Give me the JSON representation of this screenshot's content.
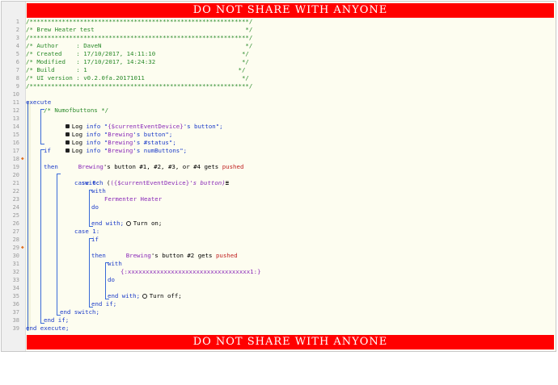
{
  "banner": {
    "top_text": "DO NOT SHARE WITH ANYONE",
    "bottom_text": "DO NOT SHARE WITH ANYONE"
  },
  "line_numbers": [
    "1",
    "2",
    "3",
    "4",
    "5",
    "6",
    "7",
    "8",
    "9",
    "10",
    "11",
    "12",
    "13",
    "14",
    "15",
    "16",
    "17",
    "18",
    "19",
    "20",
    "21",
    "22",
    "23",
    "24",
    "25",
    "26",
    "27",
    "28",
    "29",
    "30",
    "31",
    "32",
    "33",
    "34",
    "35",
    "36",
    "37",
    "38",
    "39"
  ],
  "header_comment": {
    "border": "/*************************************************************/",
    "title": "/* Brew Heater test                                          */",
    "author": "/* Author     : DaveN                                        */",
    "created": "/* Created    : 17/10/2017, 14:11:10                        */",
    "modified": "/* Modified   : 17/10/2017, 14:24:32                        */",
    "build": "/* Build      : 1                                          */",
    "ui_version": "/* UI version : v0.2.0fa.20171011                           */"
  },
  "code": {
    "execute": "execute",
    "numofbuttons_comment": "/* Numofbuttons */",
    "log1": {
      "pre": "Log ",
      "level": "info",
      "mid": " \"",
      "var": "{$currentEventDevice}",
      "post": "'s button\";"
    },
    "log2": {
      "pre": "Log ",
      "level": "info",
      "mid": " \"",
      "dev": "Brewing",
      "post": "'s button\";"
    },
    "log3": {
      "pre": "Log ",
      "level": "info",
      "mid": " \"",
      "dev": "Brewing",
      "post": "'s #status\";"
    },
    "log4": {
      "pre": "Log ",
      "level": "info",
      "mid": " \"",
      "dev": "Brewing",
      "post": "'s numButtons\";"
    },
    "if1": "if",
    "if1_cond": {
      "dev": "Brewing",
      "mid": "'s button #1, #2, #3, or #4 gets ",
      "ev": "pushed"
    },
    "then1": "then",
    "switch": {
      "kw": "switch",
      "open": " (",
      "var": "({$currentEventDevice}",
      "post": "'s button)"
    },
    "case0": "case 0:",
    "with1": "with",
    "with1_dev": "Fermenter Heater",
    "do1": "do",
    "turn_on": "Turn on;",
    "end_with1": "end with;",
    "case1": "case 1:",
    "if2": "if",
    "if2_cond": {
      "dev": "Brewing",
      "mid": "'s button #2 gets ",
      "ev": "pushed"
    },
    "then2": "then",
    "with2": "with",
    "with2_dev": "{:xxxxxxxxxxxxxxxxxxxxxxxxxxxxxxxxxx1:}",
    "do2": "do",
    "turn_off": "Turn off;",
    "end_with2": "end with;",
    "end_if2": "end if;",
    "end_switch": "end switch;",
    "end_if1": "end if;",
    "end_execute": "end execute;"
  },
  "colors": {
    "banner": "#ff0000",
    "comment": "#2a8a2a",
    "keyword": "#1a3ac8",
    "variable": "#8a2ab8",
    "event": "#c02020",
    "editor_bg": "#fdfdf0"
  }
}
